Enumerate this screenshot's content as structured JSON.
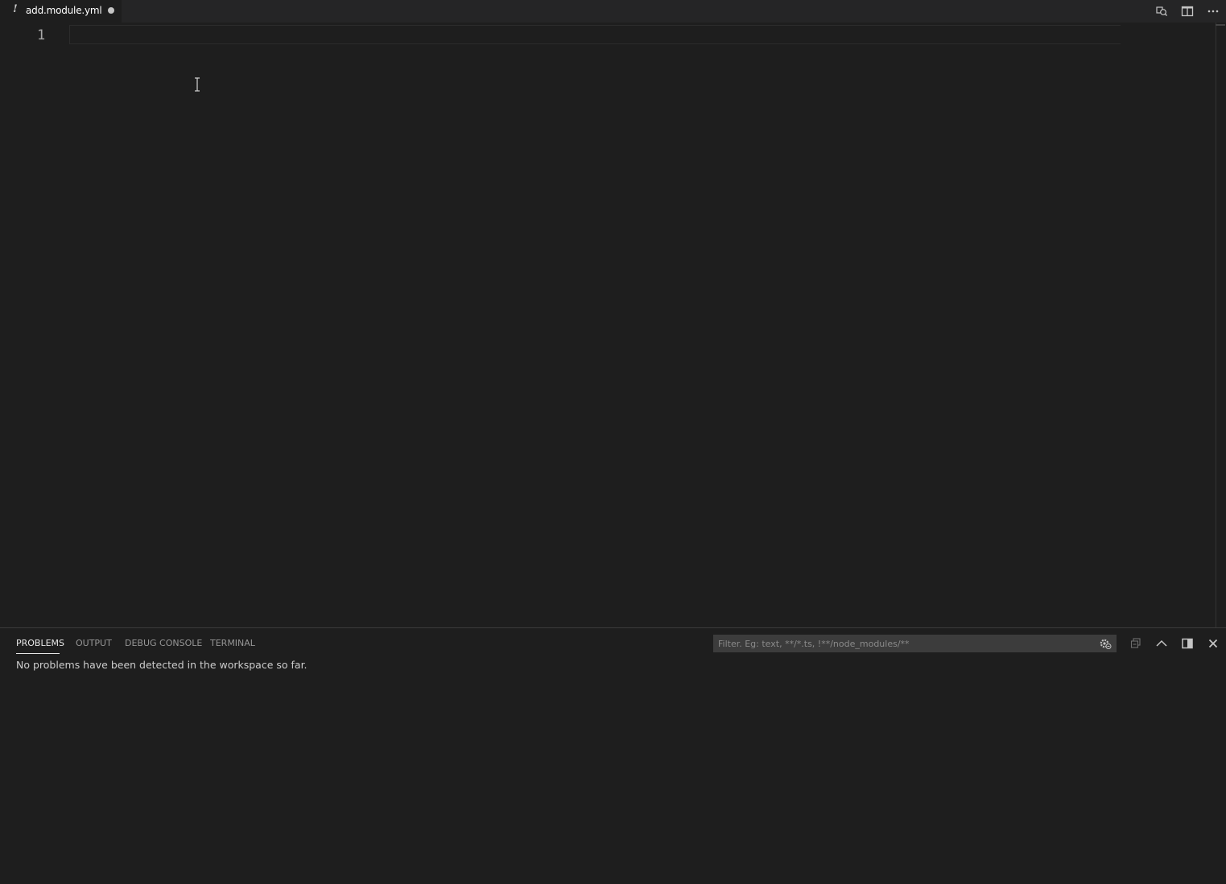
{
  "editor": {
    "tab": {
      "icon": "yaml-exclamation-icon",
      "icon_glyph": "!",
      "filename": "add.module.yml",
      "dirty": true
    },
    "actions": [
      {
        "name": "open-changes-icon"
      },
      {
        "name": "split-editor-icon"
      },
      {
        "name": "more-actions-icon"
      }
    ],
    "line_numbers": [
      "1"
    ],
    "content": ""
  },
  "panel": {
    "tabs": [
      {
        "label": "PROBLEMS",
        "active": true
      },
      {
        "label": "OUTPUT",
        "active": false
      },
      {
        "label": "DEBUG CONSOLE",
        "active": false
      },
      {
        "label": "TERMINAL",
        "active": false
      }
    ],
    "filter": {
      "placeholder": "Filter. Eg: text, **/*.ts, !**/node_modules/**",
      "value": ""
    },
    "actions": [
      {
        "name": "collapse-all-icon"
      },
      {
        "name": "maximize-panel-icon"
      },
      {
        "name": "move-panel-icon"
      },
      {
        "name": "close-panel-icon"
      }
    ],
    "message": "No problems have been detected in the workspace so far."
  },
  "colors": {
    "background": "#1e1e1e",
    "tabbar": "#252526",
    "foreground": "#cccccc"
  }
}
